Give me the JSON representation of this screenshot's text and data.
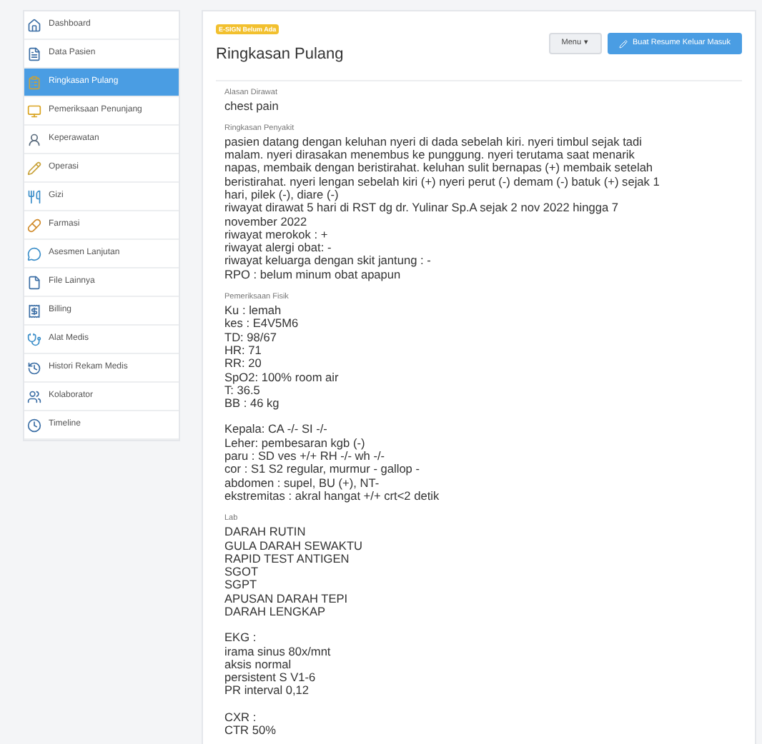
{
  "sidebar": {
    "items": [
      {
        "label": "Dashboard",
        "selected": false
      },
      {
        "label": "Data Pasien",
        "selected": false
      },
      {
        "label": "Ringkasan Pulang",
        "selected": true
      },
      {
        "label": "Pemeriksaan Penunjang",
        "selected": false
      },
      {
        "label": "Keperawatan",
        "selected": false
      },
      {
        "label": "Operasi",
        "selected": false
      },
      {
        "label": "Gizi",
        "selected": false
      },
      {
        "label": "Farmasi",
        "selected": false
      },
      {
        "label": "Asesmen Lanjutan",
        "selected": false
      },
      {
        "label": "File Lainnya",
        "selected": false
      },
      {
        "label": "Billing",
        "selected": false
      },
      {
        "label": "Alat Medis",
        "selected": false
      },
      {
        "label": "Histori Rekam Medis",
        "selected": false
      },
      {
        "label": "Kolaborator",
        "selected": false
      },
      {
        "label": "Timeline",
        "selected": false
      }
    ]
  },
  "header": {
    "badge": "E-SIGN Belum Ada",
    "title": "Ringkasan Pulang",
    "menu_button": "Menu",
    "caret": "▾",
    "primary_button": "Buat Resume Keluar Masuk"
  },
  "sections": [
    {
      "label": "Alasan Dirawat",
      "blocks": [
        [
          "chest pain"
        ]
      ]
    },
    {
      "label": "Ringkasan Penyakit",
      "blocks": [
        [
          "pasien datang dengan keluhan nyeri di dada sebelah kiri. nyeri timbul sejak tadi malam. nyeri dirasakan menembus ke punggung. nyeri terutama saat menarik napas, membaik dengan beristirahat. keluhan sulit bernapas (+) membaik setelah beristirahat. nyeri lengan sebelah kiri (+) nyeri perut (-) demam (-) batuk (+) sejak 1 hari, pilek (-), diare (-)",
          "riwayat dirawat 5 hari di RST dg dr. Yulinar Sp.A sejak 2 nov 2022 hingga 7 november 2022",
          "riwayat merokok : +",
          "riwayat alergi obat: -",
          "riwayat keluarga dengan skit jantung : -",
          "RPO : belum minum obat apapun"
        ]
      ]
    },
    {
      "label": "Pemeriksaan Fisik",
      "blocks": [
        [
          "Ku : lemah",
          "kes : E4V5M6",
          "TD: 98/67",
          "HR: 71",
          "RR: 20",
          "SpO2: 100% room air",
          "T: 36.5",
          "BB : 46 kg"
        ],
        [
          "Kepala: CA -/- SI -/-",
          "Leher: pembesaran kgb (-)",
          "paru : SD ves +/+ RH -/- wh -/-",
          "cor : S1 S2 regular, murmur - gallop -",
          "abdomen : supel, BU (+), NT-",
          "ekstremitas : akral hangat +/+ crt<2 detik"
        ]
      ]
    },
    {
      "label": "Lab",
      "blocks": [
        [
          "DARAH RUTIN",
          "GULA DARAH SEWAKTU",
          "RAPID TEST ANTIGEN",
          "SGOT",
          "SGPT",
          "APUSAN DARAH TEPI",
          "DARAH LENGKAP"
        ],
        [
          "EKG :",
          "irama sinus 80x/mnt",
          "aksis normal",
          "persistent S V1-6",
          "PR interval 0,12"
        ],
        [
          "CXR :",
          "CTR 50%"
        ]
      ]
    }
  ]
}
